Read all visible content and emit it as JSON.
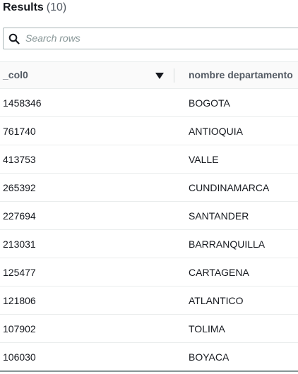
{
  "header": {
    "title": "Results",
    "count": "(10)"
  },
  "search": {
    "placeholder": "Search rows",
    "icon": "search-icon"
  },
  "table": {
    "columns": [
      "_col0",
      "nombre departamento"
    ],
    "sorted_column": "_col0",
    "sort_direction": "descending",
    "rows": [
      [
        "1458346",
        "BOGOTA"
      ],
      [
        "761740",
        "ANTIOQUIA"
      ],
      [
        "413753",
        "VALLE"
      ],
      [
        "265392",
        "CUNDINAMARCA"
      ],
      [
        "227694",
        "SANTANDER"
      ],
      [
        "213031",
        "BARRANQUILLA"
      ],
      [
        "125477",
        "CARTAGENA"
      ],
      [
        "121806",
        "ATLANTICO"
      ],
      [
        "107902",
        "TOLIMA"
      ],
      [
        "106030",
        "BOYACA"
      ]
    ]
  }
}
